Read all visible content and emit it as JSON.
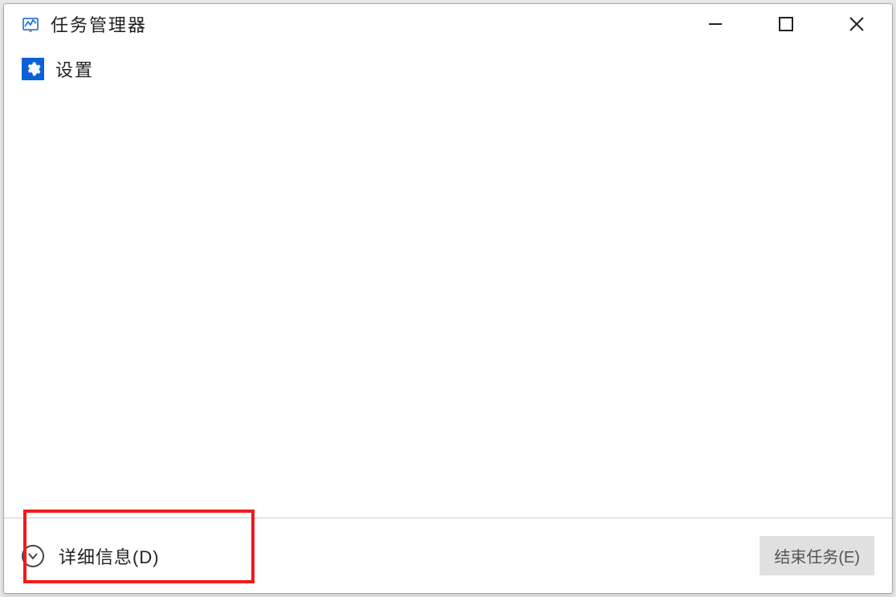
{
  "window": {
    "title": "任务管理器"
  },
  "process_list": {
    "items": [
      {
        "name": "设置",
        "icon": "gear-icon"
      }
    ]
  },
  "footer": {
    "details_label": "详细信息(D)",
    "end_task_label": "结束任务(E)"
  }
}
